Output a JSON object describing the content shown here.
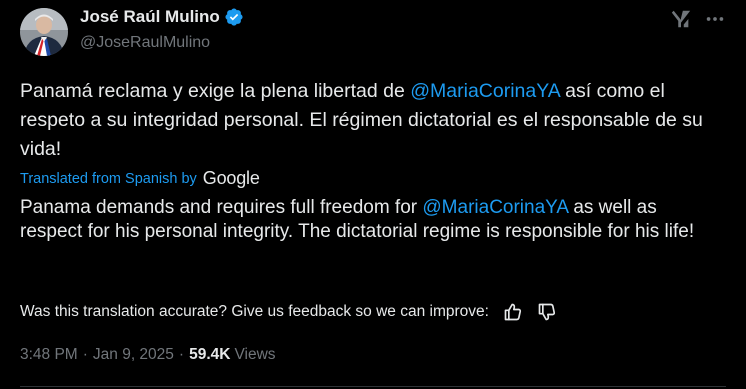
{
  "author": {
    "display_name": "José Raúl Mulino",
    "handle": "@JoseRaulMulino",
    "verified": true,
    "verified_color": "#1d9bf0"
  },
  "icons": {
    "grok": "grok-slash-icon",
    "more": "more-horizontal-icon",
    "thumb_up": "thumb-up-icon",
    "thumb_down": "thumb-down-icon"
  },
  "post": {
    "original": {
      "before_mention": "Panamá reclama y exige la plena libertad de ",
      "mention": "@MariaCorinaYA",
      "after_mention": " así como el respeto a su integridad personal. El régimen dictatorial es el responsable de su vida!"
    },
    "translation_label": "Translated from Spanish by",
    "translation_provider": "Google",
    "translated": {
      "before_mention": "Panama demands and requires full freedom for ",
      "mention": "@MariaCorinaYA",
      "after_mention": " as well as respect for his personal integrity. The dictatorial regime is responsible for his life!"
    },
    "feedback_prompt": "Was this translation accurate? Give us feedback so we can improve:"
  },
  "meta": {
    "time": "3:48 PM",
    "separator": "·",
    "date": "Jan 9, 2025",
    "views_count": "59.4K",
    "views_label": "Views"
  },
  "colors": {
    "background": "#000000",
    "text_primary": "#e7e9ea",
    "text_secondary": "#71767b",
    "accent": "#1d9bf0",
    "divider": "#2f3336"
  }
}
